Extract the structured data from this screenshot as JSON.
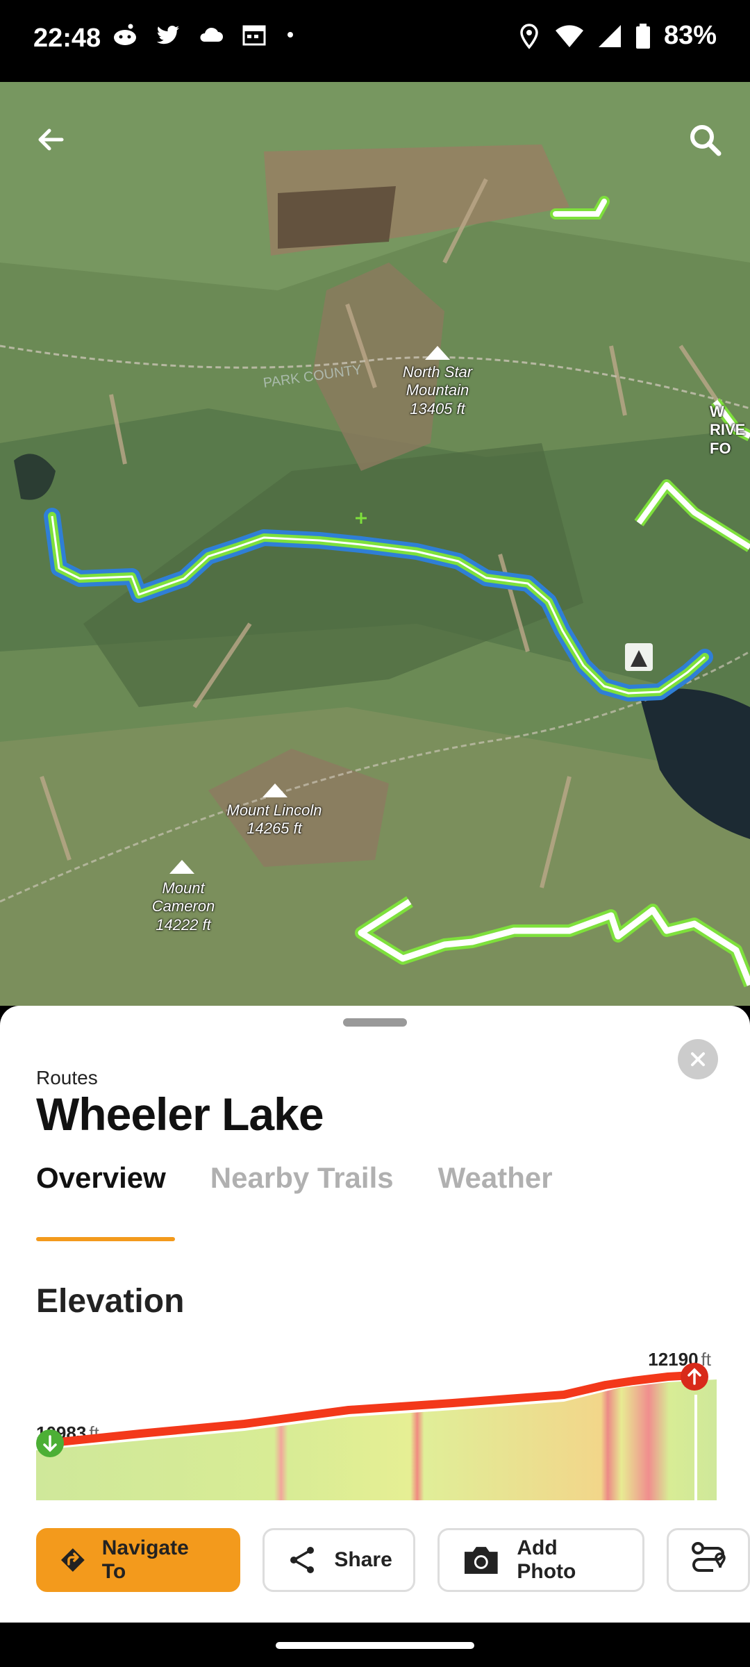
{
  "status_bar": {
    "time": "22:48",
    "battery": "83%",
    "left_icons": [
      "reddit-icon",
      "twitter-icon",
      "cloud-icon",
      "calendar-icon",
      "dot-icon"
    ],
    "right_icons": [
      "location-icon",
      "wifi-icon",
      "signal-icon",
      "battery-icon"
    ]
  },
  "map": {
    "back_icon": "arrow-left-icon",
    "search_icon": "search-icon",
    "peaks": [
      {
        "name": "North Star\nMountain",
        "elevation": "13405 ft"
      },
      {
        "name": "Mount Lincoln",
        "elevation": "14265 ft"
      },
      {
        "name": "Mount\nCameron",
        "elevation": "14222 ft"
      }
    ],
    "county_label": "PARK COUNTY",
    "edge_label": "W\nRIVE\nFO",
    "colors": {
      "route": "#7ee03c",
      "route_outline": "#2f7fd6",
      "trail": "#ffffff"
    }
  },
  "sheet": {
    "category": "Routes",
    "title": "Wheeler Lake",
    "tabs": [
      "Overview",
      "Nearby Trails",
      "Weather"
    ],
    "active_tab": "Overview",
    "section_title": "Elevation",
    "elevation": {
      "max_value": "12190",
      "min_value": "10983",
      "unit": "ft",
      "accent": "#f3381a",
      "start_marker": "arrow-down-icon",
      "end_marker": "arrow-up-icon"
    },
    "actions": [
      {
        "label": "Navigate To",
        "icon": "navigate-icon"
      },
      {
        "label": "Share",
        "icon": "share-icon"
      },
      {
        "label": "Add Photo",
        "icon": "camera-icon"
      },
      {
        "label": "",
        "icon": "route-icon"
      }
    ],
    "accent_color": "#f39a1c"
  }
}
